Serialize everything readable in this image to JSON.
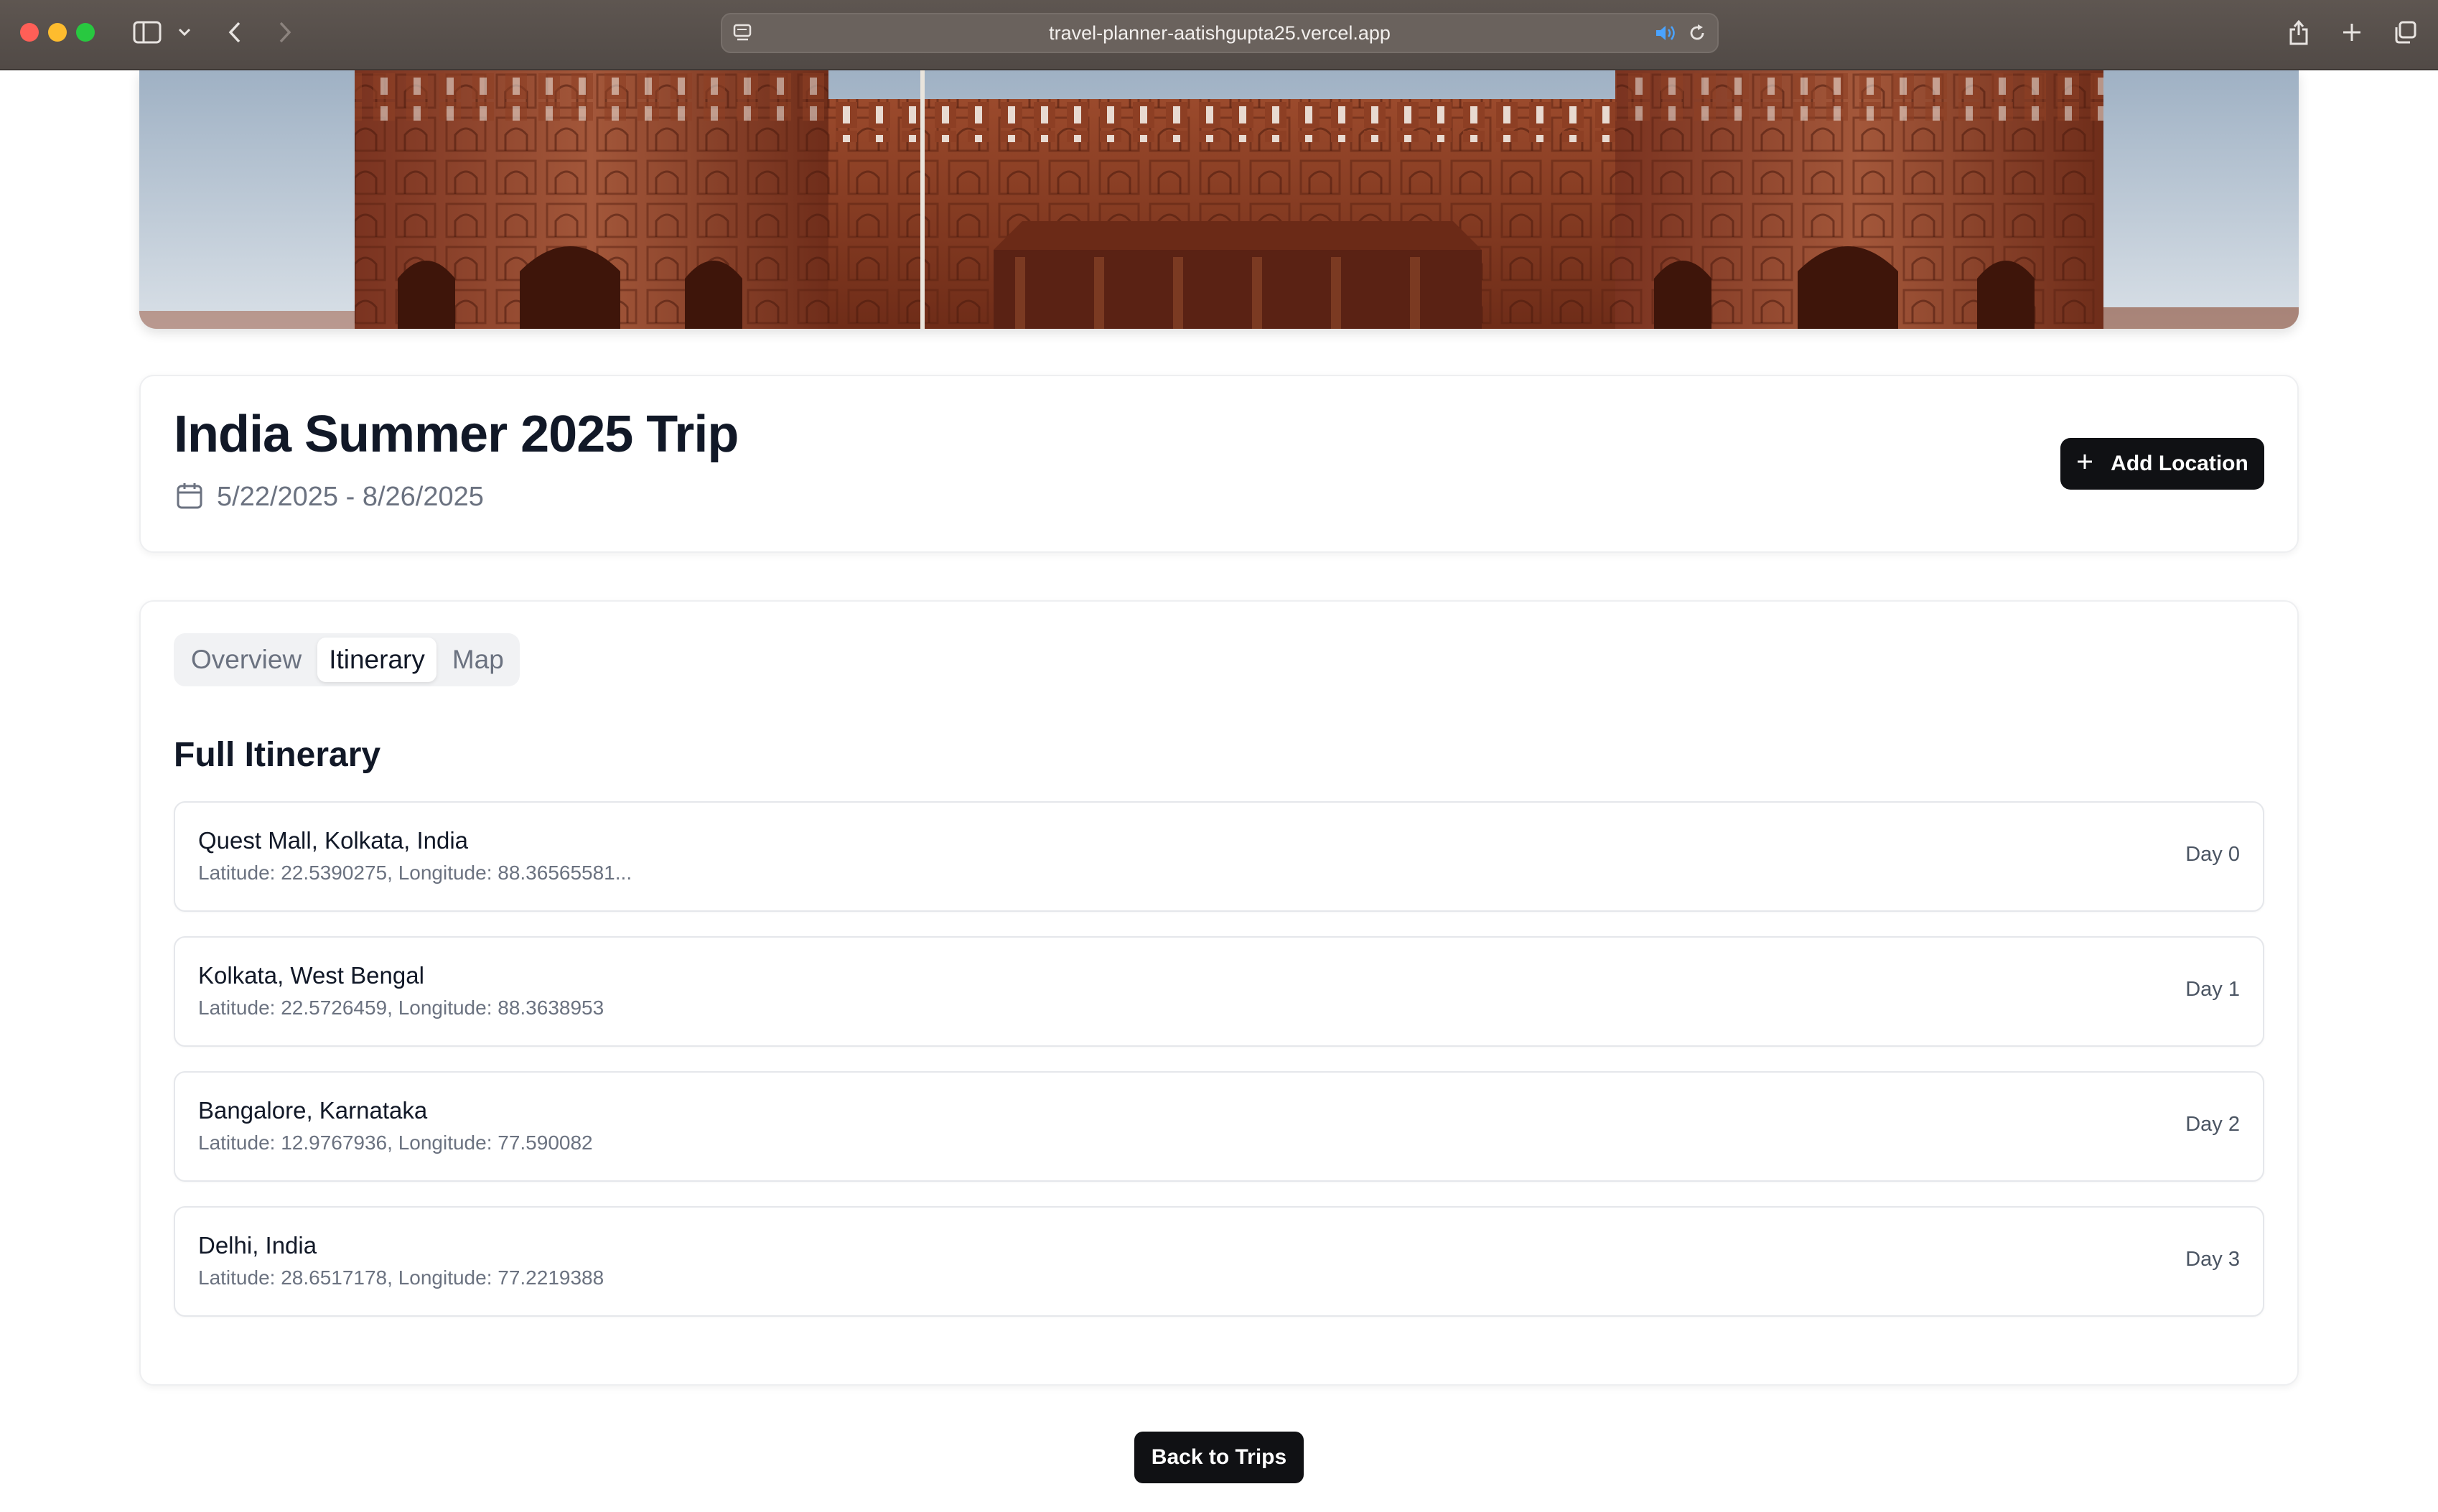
{
  "browser": {
    "url": "travel-planner-aatishgupta25.vercel.app",
    "icons": [
      "sidebar-toggle-icon",
      "chevron-down-icon",
      "back-arrow-icon",
      "forward-arrow-icon",
      "site-settings-icon",
      "audio-playing-icon",
      "reload-icon",
      "share-icon",
      "new-tab-plus-icon",
      "tab-overview-icon"
    ]
  },
  "trip": {
    "title": "India Summer 2025 Trip",
    "date_range": "5/22/2025 - 8/26/2025",
    "add_location_label": "Add Location"
  },
  "tabs": [
    {
      "label": "Overview",
      "active": false
    },
    {
      "label": "Itinerary",
      "active": true
    },
    {
      "label": "Map",
      "active": false
    }
  ],
  "itinerary": {
    "heading": "Full Itinerary",
    "items": [
      {
        "name": "Quest Mall, Kolkata, India",
        "coords": "Latitude: 22.5390275, Longitude: 88.36565581...",
        "day": "Day 0"
      },
      {
        "name": "Kolkata, West Bengal",
        "coords": "Latitude: 22.5726459, Longitude: 88.3638953",
        "day": "Day 1"
      },
      {
        "name": "Bangalore, Karnataka",
        "coords": "Latitude: 12.9767936, Longitude: 77.590082",
        "day": "Day 2"
      },
      {
        "name": "Delhi, India",
        "coords": "Latitude: 28.6517178, Longitude: 77.2219388",
        "day": "Day 3"
      }
    ]
  },
  "footer": {
    "back_label": "Back to Trips"
  },
  "colors": {
    "primary_button": "#101114",
    "muted_text": "#6b7280",
    "sandstone": "#8a3a22"
  }
}
